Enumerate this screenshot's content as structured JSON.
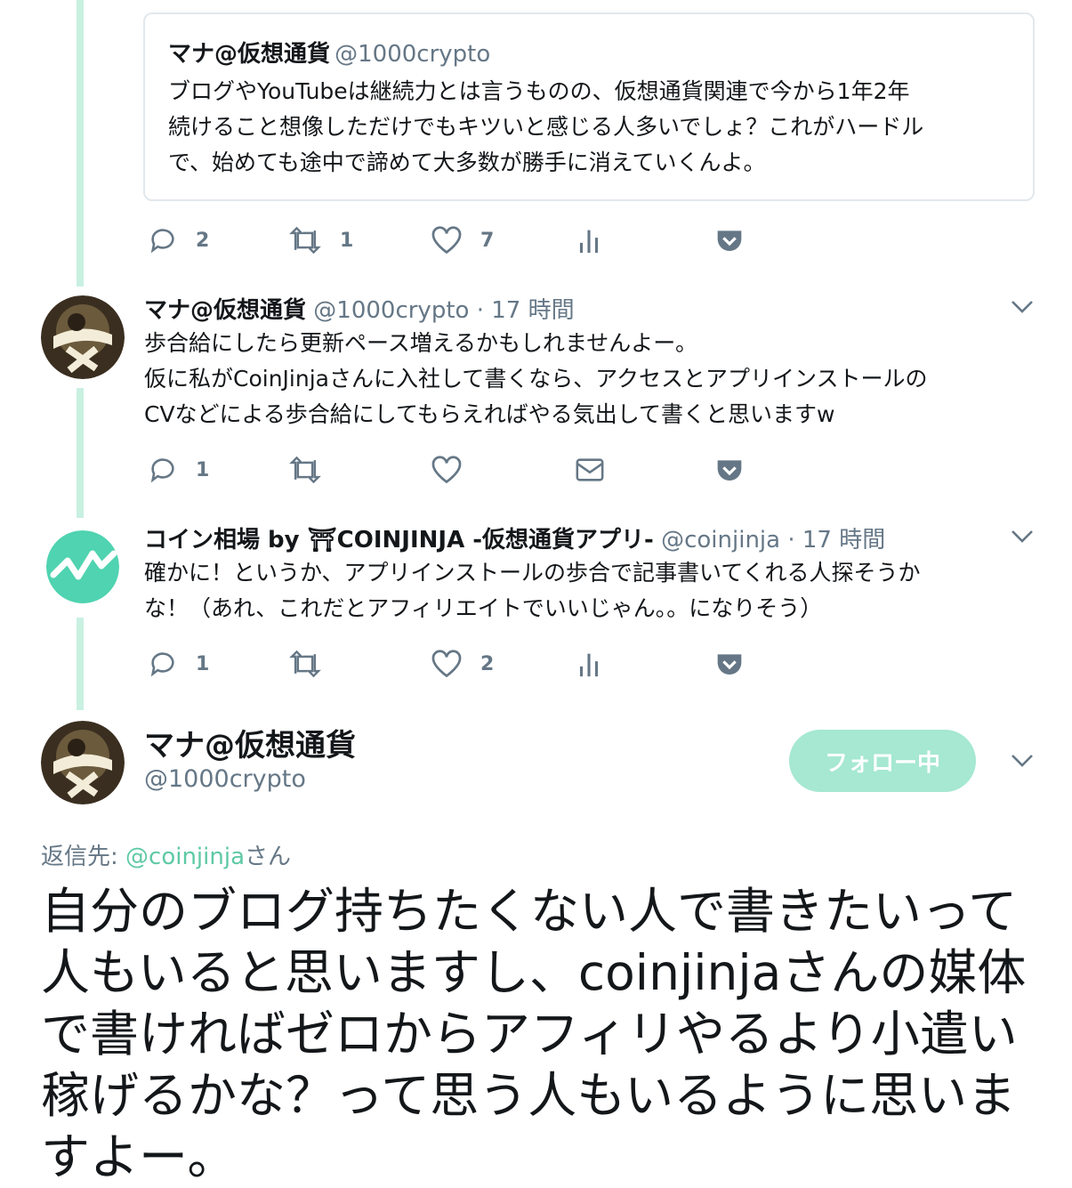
{
  "quoted": {
    "name": "マナ@仮想通貨",
    "handle": "@1000crypto",
    "text": "ブログやYouTubeは継続力とは言うものの、仮想通貨関連で今から1年2年\n続けること想像しただけでもキツいと感じる人多いでしょ？これがハードル\nで、始めても途中で諦めて大多数が勝手に消えていくんよ。",
    "actions": {
      "reply": "2",
      "retweet": "1",
      "like": "7"
    }
  },
  "tweets": [
    {
      "name": "マナ@仮想通貨",
      "handle": "@1000crypto",
      "time": "· 17 時間",
      "text": "歩合給にしたら更新ペース増えるかもしれませんよー。\n仮に私がCoinJinjaさんに入社して書くなら、アクセスとアプリインストールの\nCVなどによる歩合給にしてもらえればやる気出して書くと思いますw",
      "actions": {
        "reply": "1",
        "retweet": "",
        "like": ""
      }
    },
    {
      "name": "コイン相場 by ⛩COINJINJA -仮想通貨アプリ-",
      "handle": "@coinjinja",
      "time": "· 17 時間",
      "text": "確かに！というか、アプリインストールの歩合で記事書いてくれる人探そうか\nな！（あれ、これだとアフィリエイトでいいじゃん。。になりそう）",
      "actions": {
        "reply": "1",
        "retweet": "",
        "like": "2"
      }
    }
  ],
  "main": {
    "name": "マナ@仮想通貨",
    "handle": "@1000crypto",
    "follow_label": "フォロー中",
    "reply_prefix": "返信先: ",
    "reply_link": "@coinjinja",
    "reply_suffix": "さん",
    "text": "自分のブログ持ちたくない人で書きたいって\n人もいると思いますし、coinjinjaさんの媒体\nで書ければゼロからアフィリやるより小遣い\n稼げるかな？って思う人もいるように思いま\nすよー。"
  },
  "icons": [
    "reply-icon",
    "retweet-icon",
    "like-icon",
    "analytics-icon",
    "dm-icon",
    "pocket-icon",
    "chevron-down-icon"
  ],
  "colors": {
    "accent": "#5ec9a5",
    "thread": "#c9f0e1",
    "follow_bg": "#a6e8d1",
    "secondary": "#657786",
    "pocket": "#657786"
  }
}
